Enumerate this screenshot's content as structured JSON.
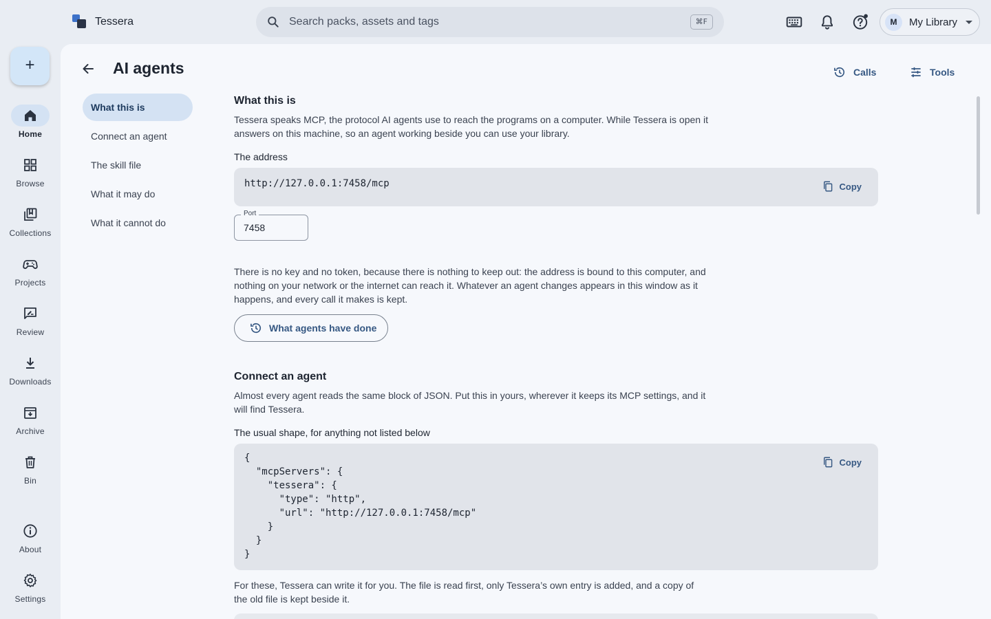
{
  "app": {
    "name": "Tessera"
  },
  "search": {
    "placeholder": "Search packs, assets and tags",
    "shortcut": "⌘F"
  },
  "topbar": {
    "icons": [
      "keyboard-icon",
      "bell-icon",
      "help-icon"
    ],
    "library": {
      "avatar": "M",
      "label": "My Library"
    }
  },
  "rail": {
    "fab_label": "+",
    "items": [
      {
        "label": "Home",
        "icon": "home-icon",
        "active": true
      },
      {
        "label": "Browse",
        "icon": "grid-icon"
      },
      {
        "label": "Collections",
        "icon": "collections-icon"
      },
      {
        "label": "Projects",
        "icon": "gamepad-icon"
      },
      {
        "label": "Review",
        "icon": "review-icon"
      },
      {
        "label": "Downloads",
        "icon": "download-icon"
      },
      {
        "label": "Archive",
        "icon": "archive-icon"
      },
      {
        "label": "Bin",
        "icon": "bin-icon"
      },
      {
        "label": "About",
        "icon": "info-icon"
      },
      {
        "label": "Settings",
        "icon": "gear-icon"
      }
    ]
  },
  "page": {
    "title": "AI agents",
    "header_buttons": {
      "calls": "Calls",
      "tools": "Tools"
    }
  },
  "toc": [
    {
      "label": "What this is",
      "active": true
    },
    {
      "label": "Connect an agent"
    },
    {
      "label": "The skill file"
    },
    {
      "label": "What it may do"
    },
    {
      "label": "What it cannot do"
    }
  ],
  "sections": {
    "what": {
      "title": "What this is",
      "intro": "Tessera speaks MCP, the protocol AI agents use to reach the programs on a computer. While Tessera is open it answers on this machine, so an agent working beside you can use your library.",
      "address_label": "The address",
      "address": "http://127.0.0.1:7458/mcp",
      "copy": "Copy",
      "port_label": "Port",
      "port": "7458",
      "security": "There is no key and no token, because there is nothing to keep out: the address is bound to this computer, and nothing on your network or the internet can reach it. Whatever an agent changes appears in this window as it happens, and every call it makes is kept.",
      "history_button": "What agents have done"
    },
    "connect": {
      "title": "Connect an agent",
      "intro": "Almost every agent reads the same block of JSON. Put this in yours, wherever it keeps its MCP settings, and it will find Tessera.",
      "shape_label": "The usual shape, for anything not listed below",
      "json": "{\n  \"mcpServers\": {\n    \"tessera\": {\n      \"type\": \"http\",\n      \"url\": \"http://127.0.0.1:7458/mcp\"\n    }\n  }\n}",
      "copy": "Copy",
      "after": "For these, Tessera can write it for you. The file is read first, only Tessera’s own entry is added, and a copy of the old file is kept beside it."
    }
  }
}
